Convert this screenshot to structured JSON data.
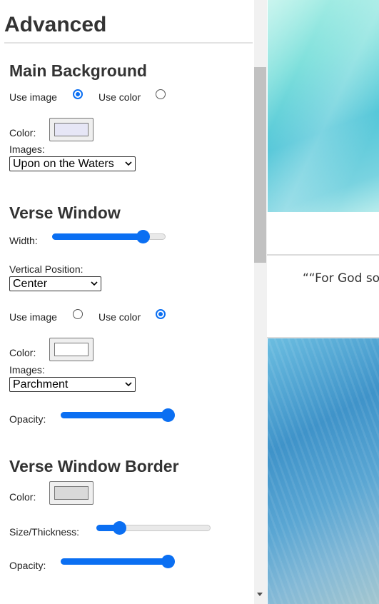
{
  "panel": {
    "title": "Advanced",
    "main_background": {
      "heading": "Main Background",
      "use_image_label": "Use image",
      "use_color_label": "Use color",
      "selected": "image",
      "color_label": "Color:",
      "color_value": "#e6e6f6",
      "images_label": "Images:",
      "images_selected": "Upon on the Waters"
    },
    "verse_window": {
      "heading": "Verse Window",
      "width_label": "Width:",
      "width_value": 0.8,
      "vertical_position_label": "Vertical Position:",
      "vertical_position_selected": "Center",
      "use_image_label": "Use image",
      "use_color_label": "Use color",
      "selected": "color",
      "color_label": "Color:",
      "color_value": "#ffffff",
      "images_label": "Images:",
      "images_selected": "Parchment",
      "opacity_label": "Opacity:",
      "opacity_value": 1.0
    },
    "verse_window_border": {
      "heading": "Verse Window Border",
      "color_label": "Color:",
      "color_value": "#d9d9d9",
      "size_label": "Size/Thickness:",
      "size_value": 0.2,
      "opacity_label": "Opacity:",
      "opacity_value": 1.0
    }
  },
  "preview": {
    "verse_text": "““For God so l"
  },
  "colors": {
    "accent": "#0b6ff2"
  }
}
